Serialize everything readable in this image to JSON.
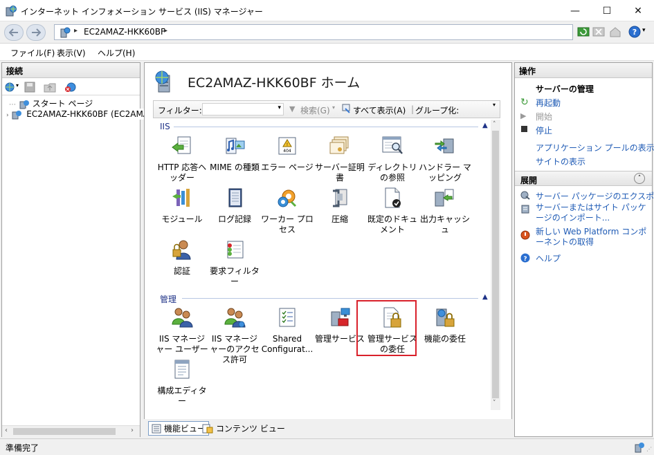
{
  "window": {
    "title": "インターネット インフォメーション サービス (IIS) マネージャー",
    "minimize": "—",
    "maximize": "☐",
    "close": "✕"
  },
  "address": {
    "server": "EC2AMAZ-HKK60BF",
    "separator": "▸"
  },
  "menu": [
    "ファイル(F)",
    "表示(V)",
    "ヘルプ(H)"
  ],
  "connections": {
    "title": "接続",
    "tree": [
      {
        "label": "スタート ページ",
        "icon": "start-page-icon"
      },
      {
        "label": "EC2AMAZ-HKK60BF (EC2AMA",
        "icon": "server-icon",
        "selected": true
      }
    ]
  },
  "center": {
    "title": "EC2AMAZ-HKK60BF ホーム",
    "filter_label": "フィルター:",
    "search_label": "検索(G)",
    "show_all_label": "すべて表示(A)",
    "group_by_label": "グループ化:",
    "groups": [
      {
        "name": "IIS",
        "features": [
          {
            "label": "HTTP 応答ヘッダー",
            "icon": "http-headers-icon"
          },
          {
            "label": "MIME の種類",
            "icon": "mime-types-icon"
          },
          {
            "label": "エラー ページ",
            "icon": "error-pages-icon"
          },
          {
            "label": "サーバー証明書",
            "icon": "server-certificates-icon"
          },
          {
            "label": "ディレクトリの参照",
            "icon": "directory-browsing-icon"
          },
          {
            "label": "ハンドラー マッピング",
            "icon": "handler-mappings-icon"
          },
          {
            "label": "モジュール",
            "icon": "modules-icon"
          },
          {
            "label": "ログ記録",
            "icon": "logging-icon"
          },
          {
            "label": "ワーカー プロセス",
            "icon": "worker-processes-icon"
          },
          {
            "label": "圧縮",
            "icon": "compression-icon"
          },
          {
            "label": "既定のドキュメント",
            "icon": "default-document-icon"
          },
          {
            "label": "出力キャッシュ",
            "icon": "output-caching-icon"
          },
          {
            "label": "認証",
            "icon": "authentication-icon"
          },
          {
            "label": "要求フィルター",
            "icon": "request-filtering-icon"
          }
        ]
      },
      {
        "name": "管理",
        "features": [
          {
            "label": "IIS マネージャー ユーザー",
            "icon": "iis-manager-users-icon"
          },
          {
            "label": "IIS マネージャーのアクセス許可",
            "icon": "iis-manager-permissions-icon"
          },
          {
            "label": "Shared Configurat...",
            "icon": "shared-configuration-icon"
          },
          {
            "label": "管理サービス",
            "icon": "management-service-icon"
          },
          {
            "label": "管理サービスの委任",
            "icon": "management-service-delegation-icon"
          },
          {
            "label": "機能の委任",
            "icon": "feature-delegation-icon"
          },
          {
            "label": "構成エディター",
            "icon": "configuration-editor-icon"
          }
        ]
      }
    ],
    "tabs": {
      "features_view": "機能ビュー",
      "content_view": "コンテンツ ビュー"
    }
  },
  "actions": {
    "title": "操作",
    "server_manage_title": "サーバーの管理",
    "restart": "再起動",
    "start": "開始",
    "stop": "停止",
    "app_pools": "アプリケーション プールの表示",
    "sites": "サイトの表示",
    "deploy_title": "展開",
    "export_package": "サーバー パッケージのエクスポート...",
    "install_package": "サーバーまたはサイト パッケージのインポート...",
    "web_platform": "新しい Web Platform コンポーネントの取得",
    "help": "ヘルプ"
  },
  "status": {
    "text": "準備完了"
  },
  "colors": {
    "accent": "#1f5bb5",
    "highlight_border": "#d9202a",
    "group_header": "#1e3287"
  }
}
